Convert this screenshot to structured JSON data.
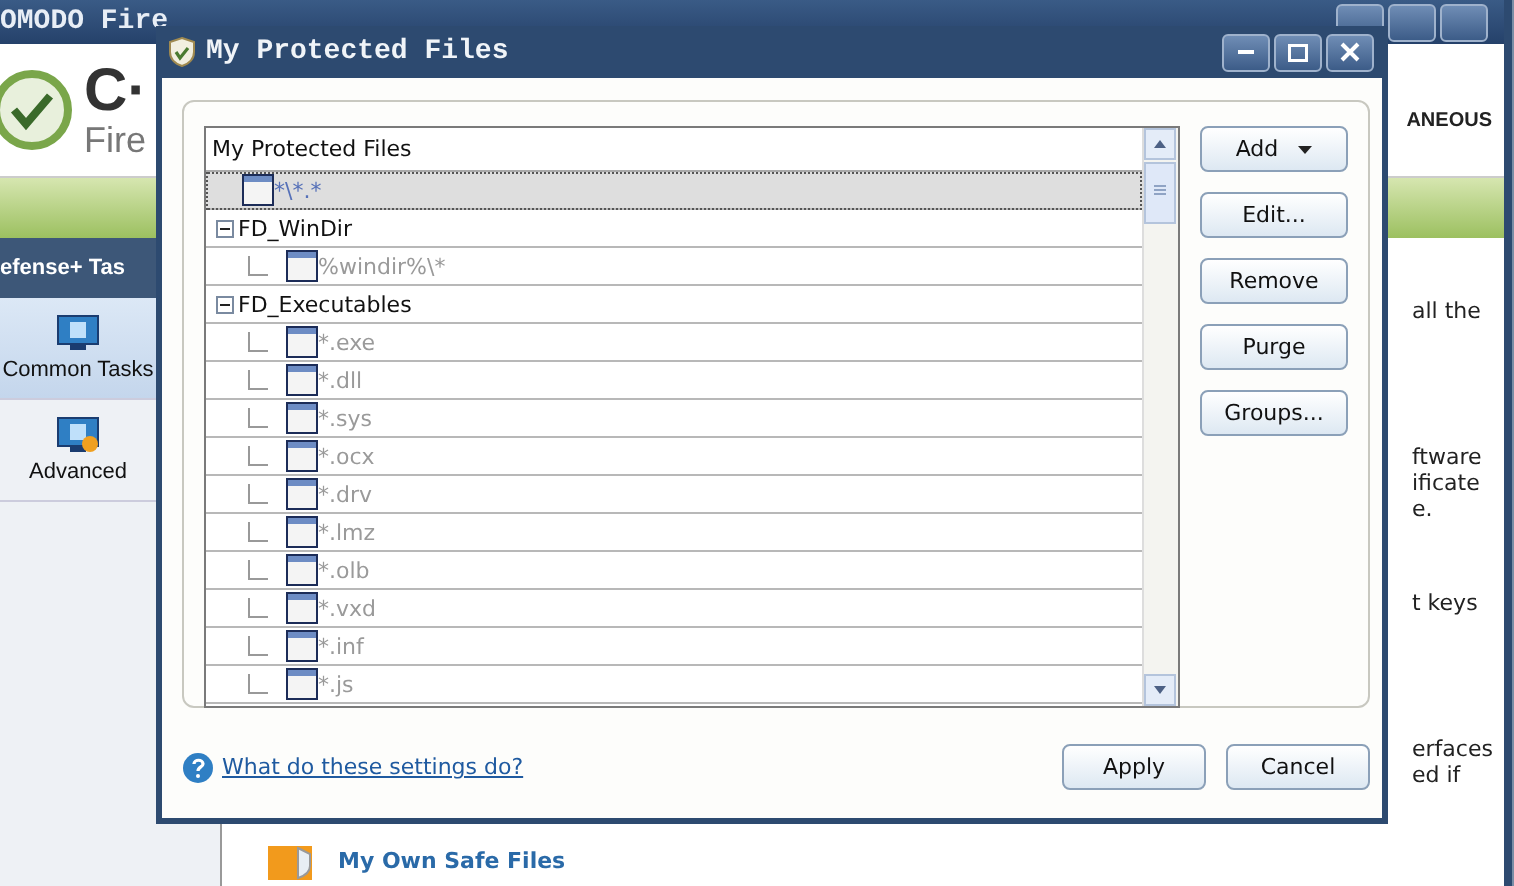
{
  "app": {
    "title": "OMODO Fire",
    "logo_text": "C·",
    "logo_subtext": "Fire",
    "category": "ANEOUS",
    "section_header": "efense+ Tas",
    "sidebar": [
      {
        "label": "Common Tasks",
        "selected": true
      },
      {
        "label": "Advanced",
        "selected": false
      }
    ],
    "content_paragraphs": [
      [
        "all the"
      ],
      [
        "ftware",
        "ificate",
        "e."
      ],
      [
        "t keys"
      ],
      [
        "erfaces",
        "ed if"
      ]
    ],
    "bottom_item": "My Own Safe Files"
  },
  "dialog": {
    "title": "My Protected Files",
    "tree_header": "My Protected Files",
    "tree": [
      {
        "label": "*\\*.*",
        "kind": "file",
        "selected": true
      },
      {
        "label": "FD_WinDir",
        "kind": "group",
        "expanded": true,
        "selected": false,
        "children": [
          {
            "label": "%windir%\\*",
            "kind": "file",
            "selected": false
          }
        ]
      },
      {
        "label": "FD_Executables",
        "kind": "group",
        "expanded": true,
        "selected": false,
        "children": [
          {
            "label": "*.exe",
            "kind": "file",
            "selected": false
          },
          {
            "label": "*.dll",
            "kind": "file",
            "selected": false
          },
          {
            "label": "*.sys",
            "kind": "file",
            "selected": false
          },
          {
            "label": "*.ocx",
            "kind": "file",
            "selected": false
          },
          {
            "label": "*.drv",
            "kind": "file",
            "selected": false
          },
          {
            "label": "*.lmz",
            "kind": "file",
            "selected": false
          },
          {
            "label": "*.olb",
            "kind": "file",
            "selected": false
          },
          {
            "label": "*.vxd",
            "kind": "file",
            "selected": false
          },
          {
            "label": "*.inf",
            "kind": "file",
            "selected": false
          },
          {
            "label": "*.js",
            "kind": "file",
            "selected": false
          }
        ]
      }
    ],
    "buttons": [
      {
        "label": "Add",
        "kind": "dropdown"
      },
      {
        "label": "Edit...",
        "kind": "plain"
      },
      {
        "label": "Remove",
        "kind": "plain"
      },
      {
        "label": "Purge",
        "kind": "plain"
      },
      {
        "label": "Groups...",
        "kind": "plain"
      }
    ],
    "help_link": "What do these settings do?",
    "footer_buttons": [
      "Apply",
      "Cancel"
    ]
  }
}
